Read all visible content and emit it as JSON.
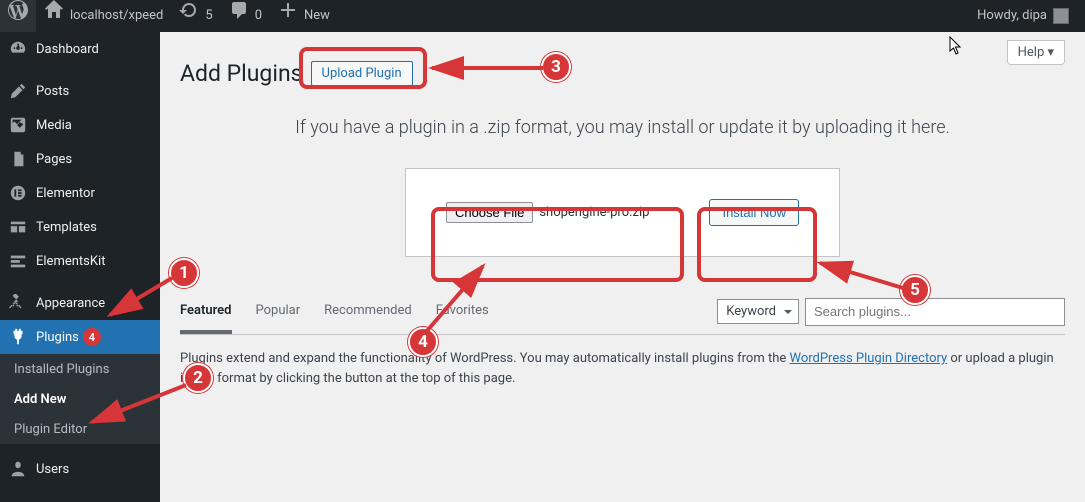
{
  "adminbar": {
    "site_name": "localhost/xpeed",
    "updates_count": "5",
    "comments_count": "0",
    "new_label": "New",
    "howdy": "Howdy, dipa"
  },
  "sidebar": {
    "dashboard": "Dashboard",
    "posts": "Posts",
    "media": "Media",
    "pages": "Pages",
    "elementor": "Elementor",
    "templates": "Templates",
    "elementskit": "ElementsKit",
    "appearance": "Appearance",
    "plugins": "Plugins",
    "plugins_badge": "4",
    "installed_plugins": "Installed Plugins",
    "add_new": "Add New",
    "plugin_editor": "Plugin Editor",
    "users": "Users"
  },
  "page": {
    "title": "Add Plugins",
    "upload_plugin_btn": "Upload Plugin",
    "help_btn": "Help ▾",
    "upload_desc": "If you have a plugin in a .zip format, you may install or update it by uploading it here.",
    "choose_file_btn": "Choose File",
    "file_name": "shopengine-pro.zip",
    "install_now_btn": "Install Now",
    "tabs": {
      "featured": "Featured",
      "popular": "Popular",
      "recommended": "Recommended",
      "favorites": "Favorites"
    },
    "keyword_label": "Keyword",
    "search_placeholder": "Search plugins...",
    "desc_before": "Plugins extend and expand the functionality of WordPress. You may automatically install plugins from the ",
    "desc_link": "WordPress Plugin Directory",
    "desc_after": " or upload a plugin in .zip format by clicking the button at the top of this page."
  },
  "annotations": {
    "n1": "1",
    "n2": "2",
    "n3": "3",
    "n4": "4",
    "n5": "5"
  }
}
